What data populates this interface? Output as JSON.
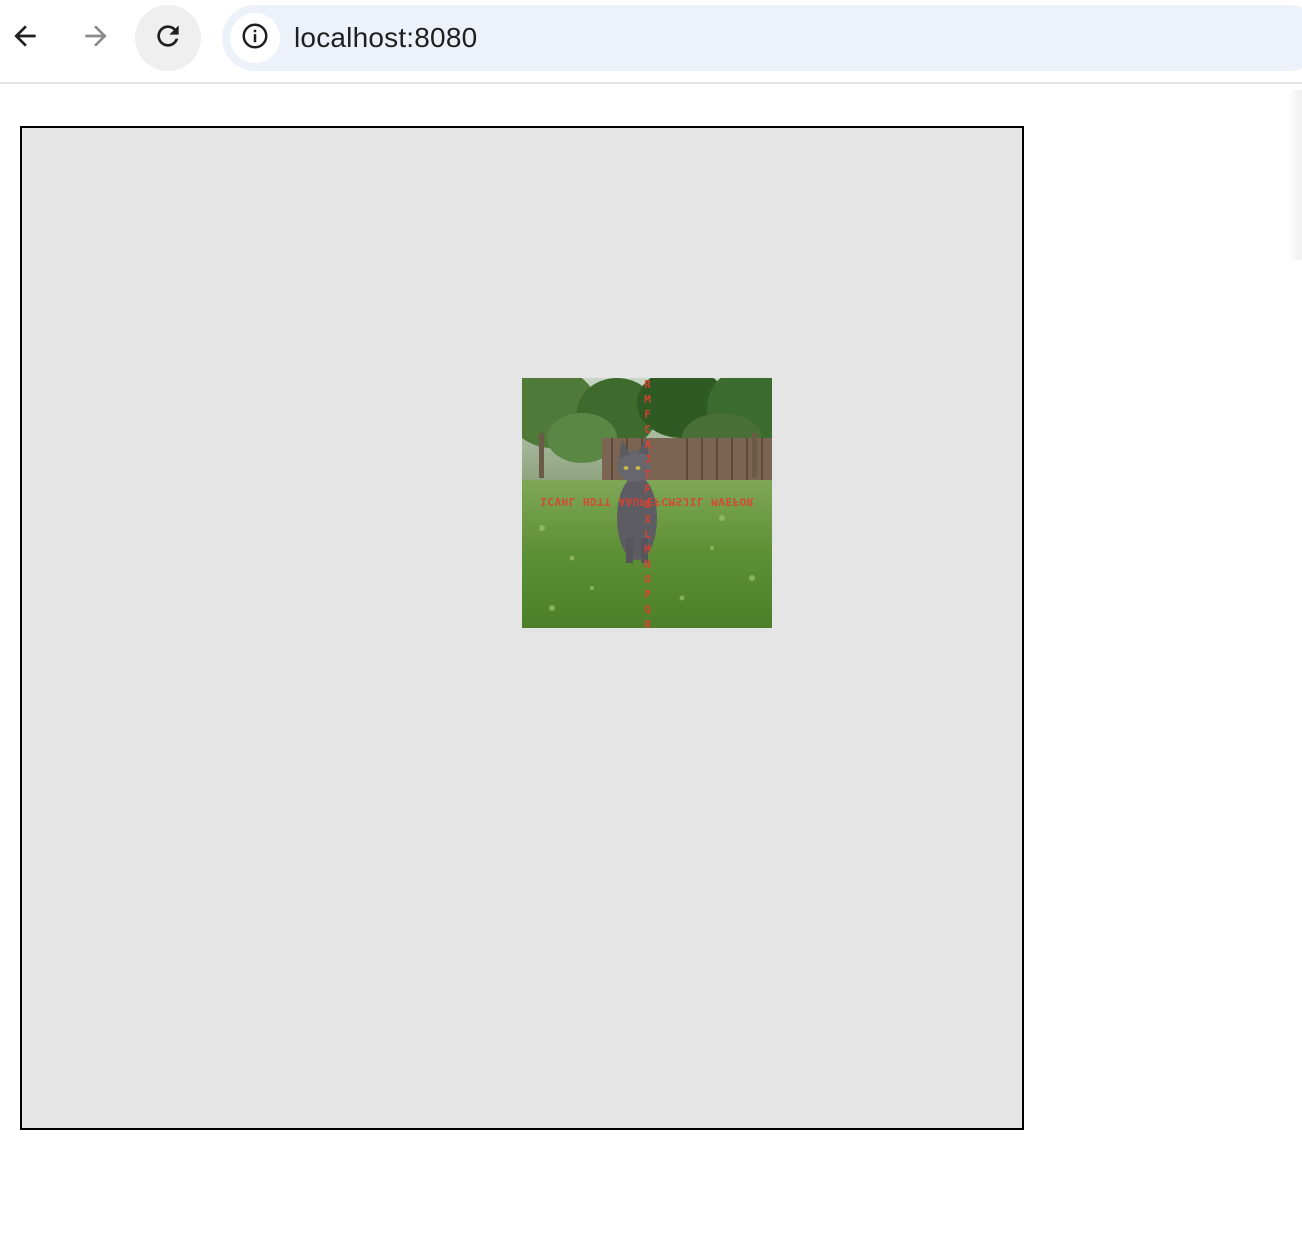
{
  "browser": {
    "url": "localhost:8080",
    "icons": {
      "back": "back-arrow-icon",
      "forward": "forward-arrow-icon",
      "reload": "reload-icon",
      "site_info": "info-icon"
    }
  },
  "photo": {
    "description_icon": "cat-photo",
    "overlay_horizontal": "1CVHL HDTT AAUPEFCMSJIL MVEFOR",
    "overlay_vertical": "RMFCAJTFIXLMNOPQR"
  },
  "colors": {
    "canvas_bg": "#e5e5e5",
    "canvas_border": "#000000",
    "omnibox_bg": "#edf1f9",
    "overlay_text": "#e0402f"
  }
}
